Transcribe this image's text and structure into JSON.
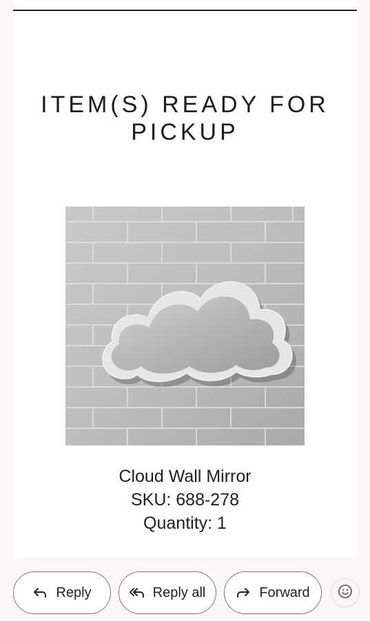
{
  "email": {
    "headline": "ITEM(S) READY FOR PICKUP",
    "product": {
      "image_alt": "Cloud Wall Mirror",
      "name": "Cloud Wall Mirror",
      "sku": "SKU: 688-278",
      "quantity": "Quantity: 1"
    }
  },
  "actions": {
    "reply_label": "Reply",
    "reply_all_label": "Reply all",
    "forward_label": "Forward",
    "reply_icon": "reply-arrow-icon",
    "reply_all_icon": "reply-all-arrow-icon",
    "forward_icon": "forward-arrow-icon",
    "emoji_icon": "smiley-icon"
  },
  "colors": {
    "page_background": "#fbf7f8",
    "card_background": "#ffffff",
    "rule": "#1e1e1e",
    "pill_border": "#7a7678"
  }
}
